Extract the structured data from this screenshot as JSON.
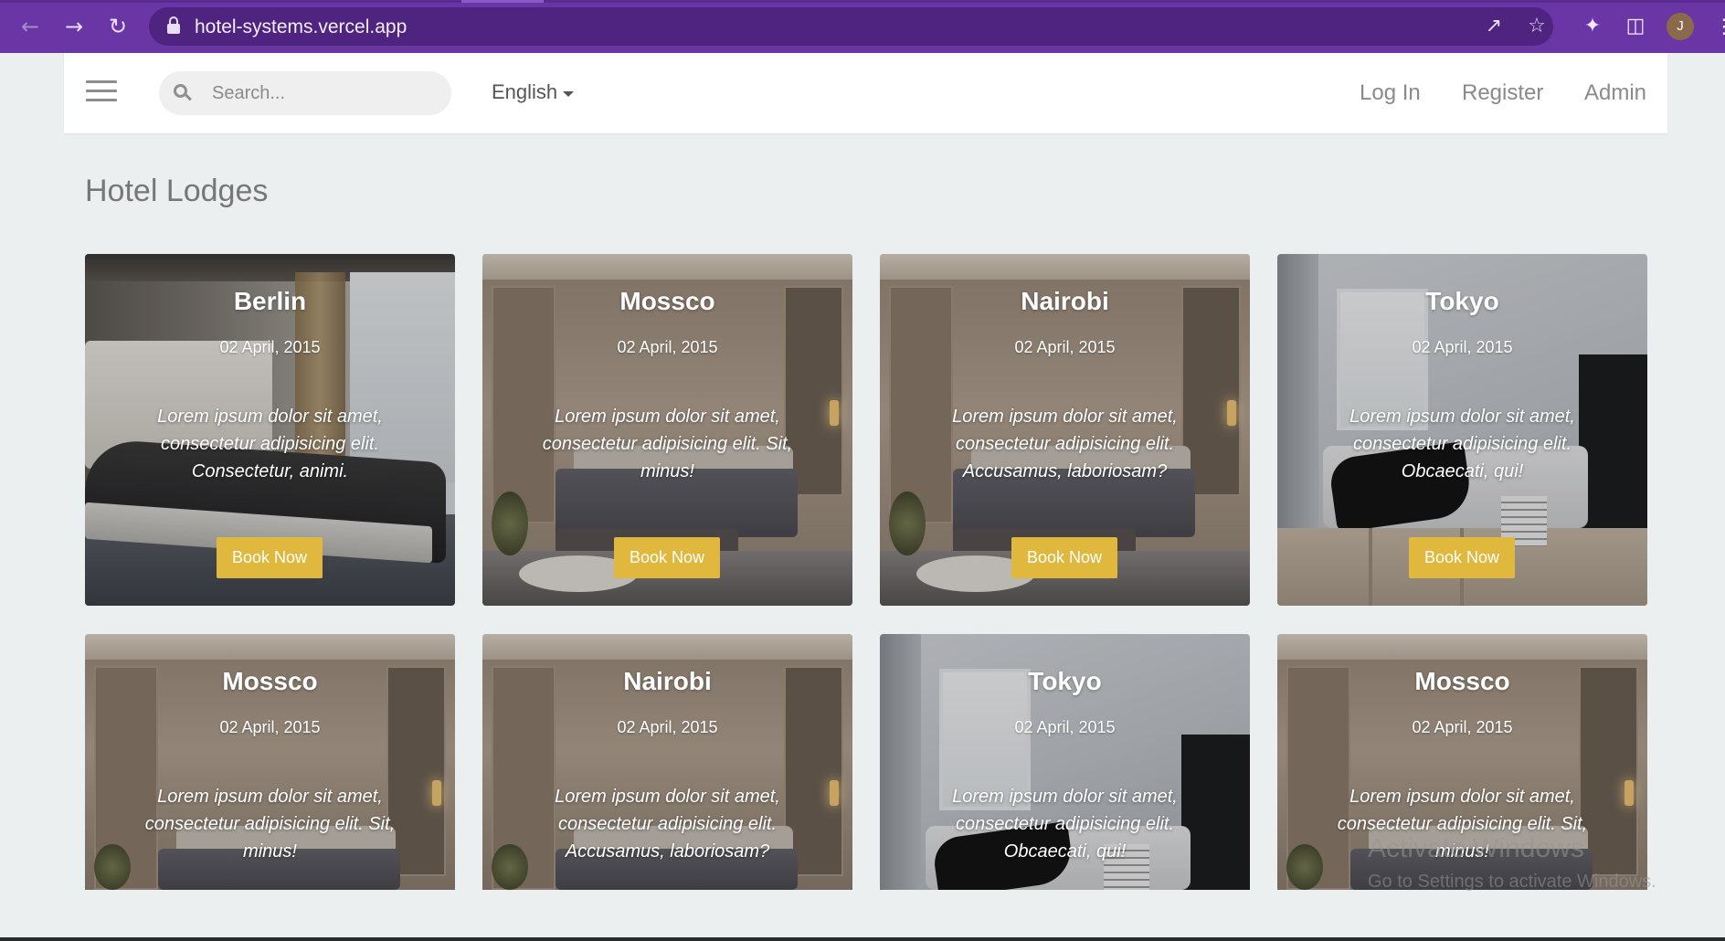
{
  "browser": {
    "url": "hotel-systems.vercel.app",
    "profile_initial": "J"
  },
  "header": {
    "search_placeholder": "Search...",
    "language": "English",
    "nav": [
      "Log In",
      "Register",
      "Admin"
    ]
  },
  "page": {
    "title": "Hotel Lodges"
  },
  "book_label": "Book Now",
  "hotels": [
    {
      "city": "Berlin",
      "date": "02 April, 2015",
      "description": "Lorem ipsum dolor sit amet, consectetur adipisicing elit. Consectetur, animi.",
      "scene": "modern"
    },
    {
      "city": "Mossco",
      "date": "02 April, 2015",
      "description": "Lorem ipsum dolor sit amet, consectetur adipisicing elit. Sit, minus!",
      "scene": "warm"
    },
    {
      "city": "Nairobi",
      "date": "02 April, 2015",
      "description": "Lorem ipsum dolor sit amet, consectetur adipisicing elit. Accusamus, laboriosam?",
      "scene": "warm"
    },
    {
      "city": "Tokyo",
      "date": "02 April, 2015",
      "description": "Lorem ipsum dolor sit amet, consectetur adipisicing elit. Obcaecati, qui!",
      "scene": "loft"
    },
    {
      "city": "Mossco",
      "date": "02 April, 2015",
      "description": "Lorem ipsum dolor sit amet, consectetur adipisicing elit. Sit, minus!",
      "scene": "warm"
    },
    {
      "city": "Nairobi",
      "date": "02 April, 2015",
      "description": "Lorem ipsum dolor sit amet, consectetur adipisicing elit. Accusamus, laboriosam?",
      "scene": "warm"
    },
    {
      "city": "Tokyo",
      "date": "02 April, 2015",
      "description": "Lorem ipsum dolor sit amet, consectetur adipisicing elit. Obcaecati, qui!",
      "scene": "loft"
    },
    {
      "city": "Mossco",
      "date": "02 April, 2015",
      "description": "Lorem ipsum dolor sit amet, consectetur adipisicing elit. Sit, minus!",
      "scene": "warm"
    }
  ],
  "watermark": {
    "line1": "Activate Windows",
    "line2": "Go to Settings to activate Windows."
  },
  "colors": {
    "browser_bar": "#6a35a5",
    "book_button": "#e0b83d",
    "page_background": "#eceff0"
  }
}
